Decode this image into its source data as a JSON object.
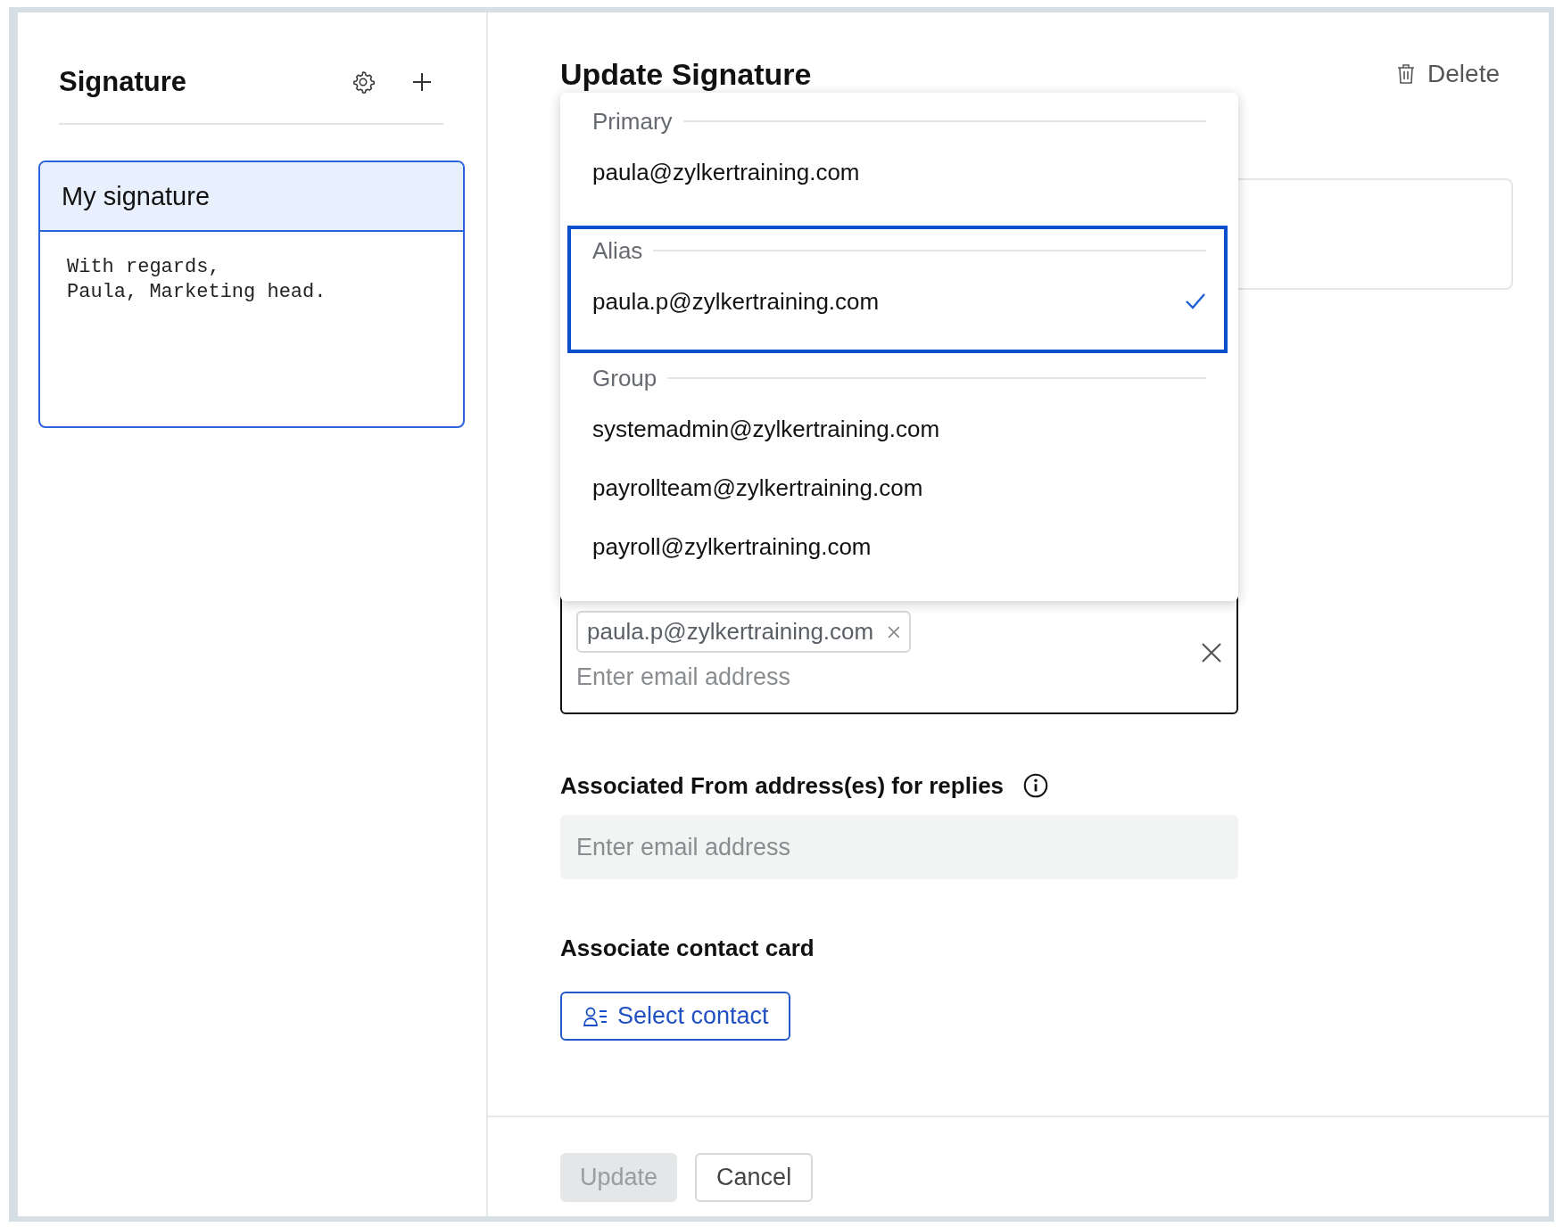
{
  "sidebar": {
    "title": "Signature",
    "signatures": [
      {
        "name": "My signature",
        "selected": true,
        "preview": [
          "With regards,",
          "Paula, Marketing head."
        ]
      }
    ]
  },
  "main": {
    "title": "Update Signature",
    "delete_label": "Delete",
    "from_dropdown": {
      "groups": [
        {
          "label": "Primary",
          "focused": false,
          "options": [
            {
              "email": "paula@zylkertraining.com",
              "selected": false
            }
          ]
        },
        {
          "label": "Alias",
          "focused": true,
          "options": [
            {
              "email": "paula.p@zylkertraining.com",
              "selected": true
            }
          ]
        },
        {
          "label": "Group",
          "focused": false,
          "options": [
            {
              "email": "systemadmin@zylkertraining.com",
              "selected": false
            },
            {
              "email": "payrollteam@zylkertraining.com",
              "selected": false
            },
            {
              "email": "payroll@zylkertraining.com",
              "selected": false
            }
          ]
        }
      ]
    },
    "from_field": {
      "chips": [
        "paula.p@zylkertraining.com"
      ],
      "placeholder": "Enter email address"
    },
    "reply_from": {
      "label": "Associated From address(es) for replies",
      "placeholder": "Enter email address"
    },
    "contact_card": {
      "label": "Associate contact card",
      "button": "Select contact"
    },
    "buttons": [
      {
        "label": "Update",
        "kind": "primary",
        "disabled": true
      },
      {
        "label": "Cancel",
        "kind": "secondary",
        "disabled": false
      }
    ]
  }
}
